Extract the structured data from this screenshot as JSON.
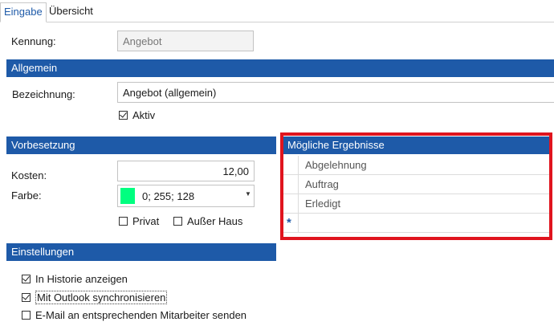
{
  "tabs": [
    {
      "label": "Eingabe",
      "active": true
    },
    {
      "label": "Übersicht",
      "active": false
    }
  ],
  "kennung": {
    "label": "Kennung:",
    "value": "Angebot"
  },
  "allgemein": {
    "header": "Allgemein",
    "bezeichnung_label": "Bezeichnung:",
    "bezeichnung_value": "Angebot (allgemein)",
    "aktiv_label": "Aktiv",
    "aktiv_checked": true
  },
  "vorbesetzung": {
    "header": "Vorbesetzung",
    "kosten_label": "Kosten:",
    "kosten_value": "12,00",
    "farbe_label": "Farbe:",
    "farbe_value": "0; 255; 128",
    "farbe_color": "#00ff80",
    "privat_label": "Privat",
    "privat_checked": false,
    "ausser_haus_label": "Außer Haus",
    "ausser_haus_checked": false
  },
  "ergebnisse": {
    "header": "Mögliche Ergebnisse",
    "rows": [
      "Abgelehnung",
      "Auftrag",
      "Erledigt"
    ],
    "new_row_marker": "*"
  },
  "einstellungen": {
    "header": "Einstellungen",
    "items": [
      {
        "label": "In Historie anzeigen",
        "checked": true
      },
      {
        "label": "Mit Outlook synchronisieren",
        "checked": true
      },
      {
        "label": "E-Mail an entsprechenden Mitarbeiter senden",
        "checked": false
      }
    ]
  },
  "colors": {
    "accent": "#1e5aa8",
    "highlight": "#e0141e"
  }
}
